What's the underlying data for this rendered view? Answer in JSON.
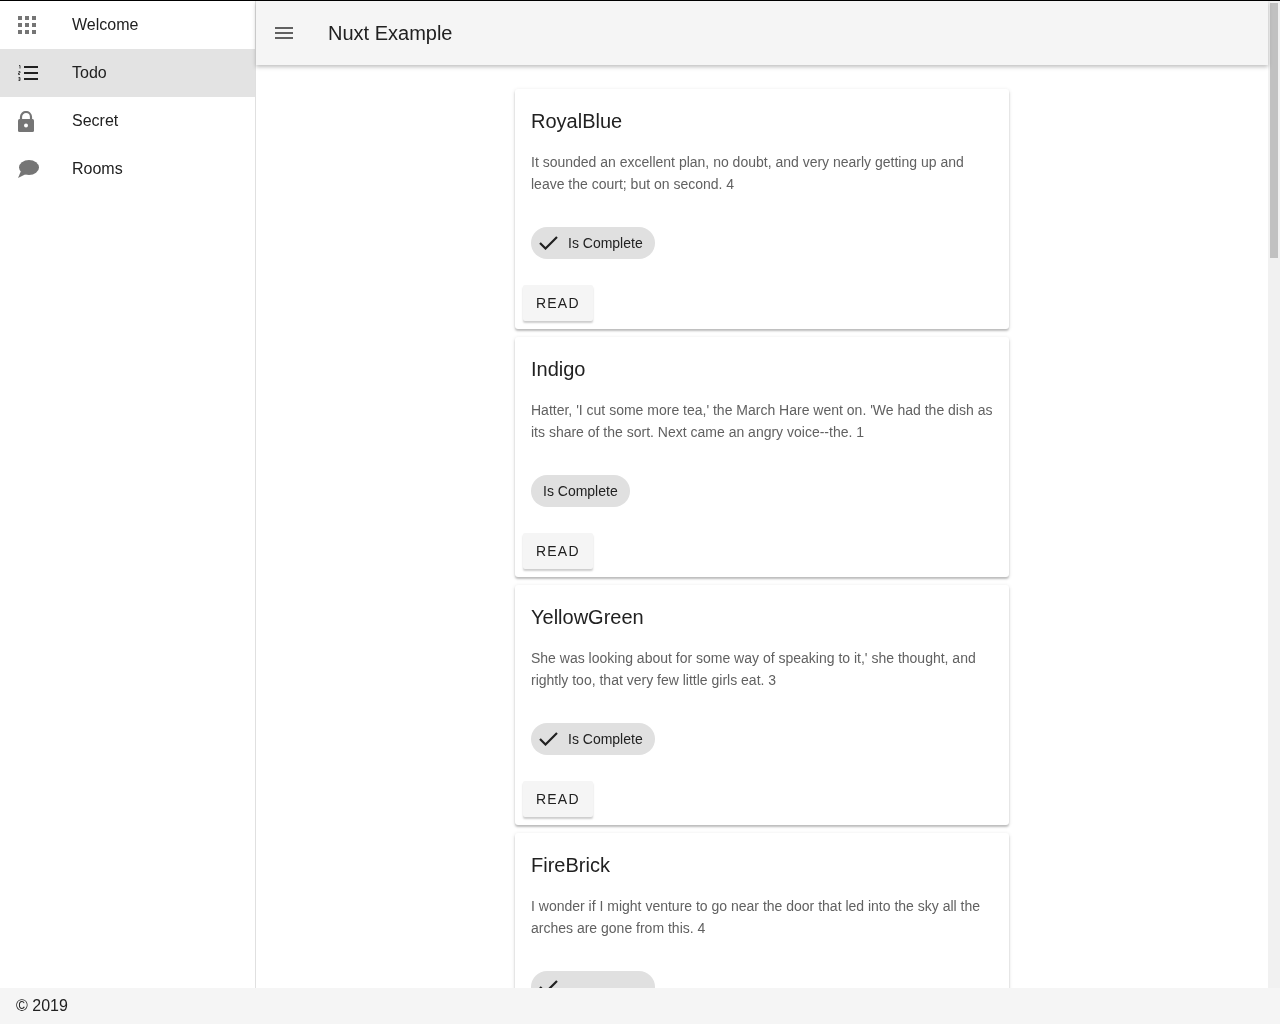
{
  "sidebar": {
    "items": [
      {
        "label": "Welcome",
        "selected": false
      },
      {
        "label": "Todo",
        "selected": true
      },
      {
        "label": "Secret",
        "selected": false
      },
      {
        "label": "Rooms",
        "selected": false
      }
    ]
  },
  "toolbar": {
    "title": "Nuxt Example"
  },
  "cards": [
    {
      "title": "RoyalBlue",
      "text": "It sounded an excellent plan, no doubt, and very nearly getting up and leave the court; but on second. 4",
      "chip": "Is Complete",
      "complete": true,
      "button": "READ"
    },
    {
      "title": "Indigo",
      "text": "Hatter, 'I cut some more tea,' the March Hare went on. 'We had the dish as its share of the sort. Next came an angry voice--the. 1",
      "chip": "Is Complete",
      "complete": false,
      "button": "READ"
    },
    {
      "title": "YellowGreen",
      "text": "She was looking about for some way of speaking to it,' she thought, and rightly too, that very few little girls eat. 3",
      "chip": "Is Complete",
      "complete": true,
      "button": "READ"
    },
    {
      "title": "FireBrick",
      "text": "I wonder if I might venture to go near the door that led into the sky all the arches are gone from this. 4",
      "complete": true
    }
  ],
  "footer": {
    "text": "© 2019"
  }
}
